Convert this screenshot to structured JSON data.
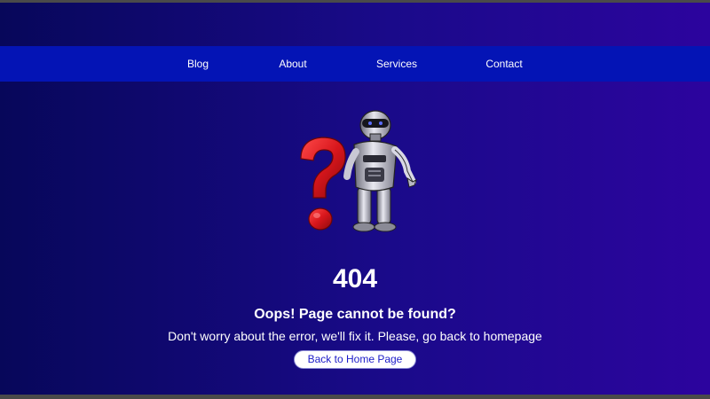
{
  "nav": {
    "items": [
      {
        "label": "Blog"
      },
      {
        "label": "About"
      },
      {
        "label": "Services"
      },
      {
        "label": "Contact"
      }
    ]
  },
  "illustration": {
    "icon": "robot-question-mark-illustration"
  },
  "error": {
    "code": "404",
    "heading": "Oops! Page cannot be found?",
    "message": "Don't worry about the error, we'll fix it. Please, go back to homepage",
    "button_label": "Back to Home Page"
  },
  "colors": {
    "nav_bar": "#0414b5",
    "background_left": "#07075a",
    "background_right": "#2c049e",
    "question_mark": "#d8161c",
    "button_text": "#1c1cc8"
  }
}
